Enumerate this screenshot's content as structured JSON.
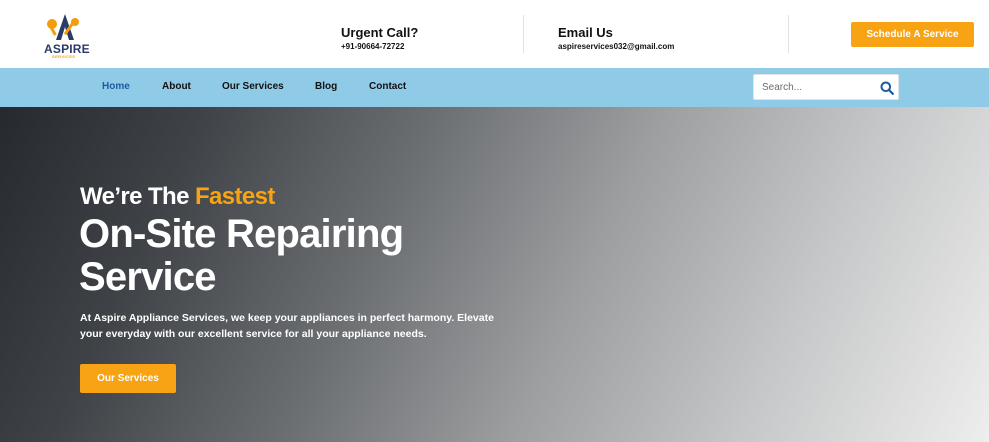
{
  "brand": {
    "name": "ASPIRE",
    "tagline": "SERVICES",
    "colors": {
      "accent": "#f7a313",
      "nav_bg": "#8fcbe7",
      "navy": "#2b3a67"
    }
  },
  "header": {
    "urgent_title": "Urgent Call?",
    "urgent_phone": "+91-90664-72722",
    "email_title": "Email Us",
    "email_address": "aspireservices032@gmail.com",
    "schedule_label": "Schedule A Service"
  },
  "nav": {
    "items": [
      {
        "label": "Home",
        "active": true
      },
      {
        "label": "About"
      },
      {
        "label": "Our Services"
      },
      {
        "label": "Blog"
      },
      {
        "label": "Contact"
      }
    ],
    "search_placeholder": "Search...",
    "search_icon": "search-icon"
  },
  "hero": {
    "prefix": "We’re The ",
    "highlight": "Fastest",
    "heading": "On-Site Repairing Service",
    "description": "At Aspire Appliance Services, we keep your appliances in perfect harmony. Elevate your everyday with our excellent service for all your appliance needs.",
    "cta_label": "Our Services"
  }
}
